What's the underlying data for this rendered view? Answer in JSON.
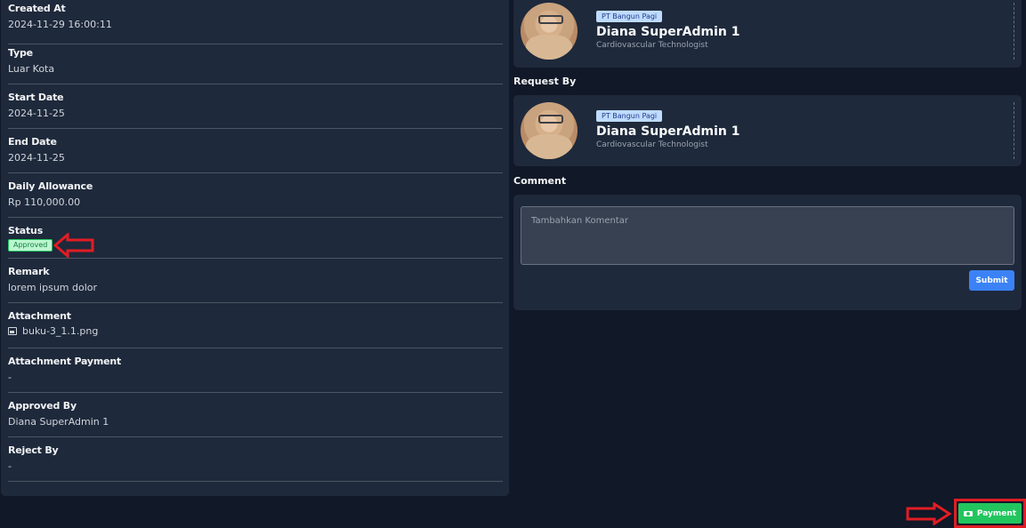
{
  "details": {
    "created_at": {
      "label": "Created At",
      "value": "2024-11-29 16:00:11"
    },
    "type": {
      "label": "Type",
      "value": "Luar Kota"
    },
    "start_date": {
      "label": "Start Date",
      "value": "2024-11-25"
    },
    "end_date": {
      "label": "End Date",
      "value": "2024-11-25"
    },
    "daily_allowance": {
      "label": "Daily Allowance",
      "value": "Rp 110,000.00"
    },
    "status": {
      "label": "Status",
      "value": "Approved"
    },
    "remark": {
      "label": "Remark",
      "value": "lorem ipsum dolor"
    },
    "attachment": {
      "label": "Attachment",
      "value": "buku-3_1.1.png"
    },
    "attachment_payment": {
      "label": "Attachment Payment",
      "value": "-"
    },
    "approved_by": {
      "label": "Approved By",
      "value": "Diana SuperAdmin 1"
    },
    "reject_by": {
      "label": "Reject By",
      "value": "-"
    }
  },
  "employee_card": {
    "company": "PT Bangun Pagi",
    "name": "Diana SuperAdmin 1",
    "role": "Cardiovascular Technologist"
  },
  "request_by": {
    "title": "Request By",
    "company": "PT Bangun Pagi",
    "name": "Diana SuperAdmin 1",
    "role": "Cardiovascular Technologist"
  },
  "comment": {
    "title": "Comment",
    "placeholder": "Tambahkan Komentar",
    "submit_label": "Submit"
  },
  "actions": {
    "payment_label": "Payment"
  },
  "colors": {
    "page_bg": "#111827",
    "panel_bg": "#1e293b",
    "approved_badge": "#bbf7d0",
    "submit_blue": "#3b82f6",
    "payment_green": "#22c55e",
    "annotation_red": "#e11d24"
  }
}
